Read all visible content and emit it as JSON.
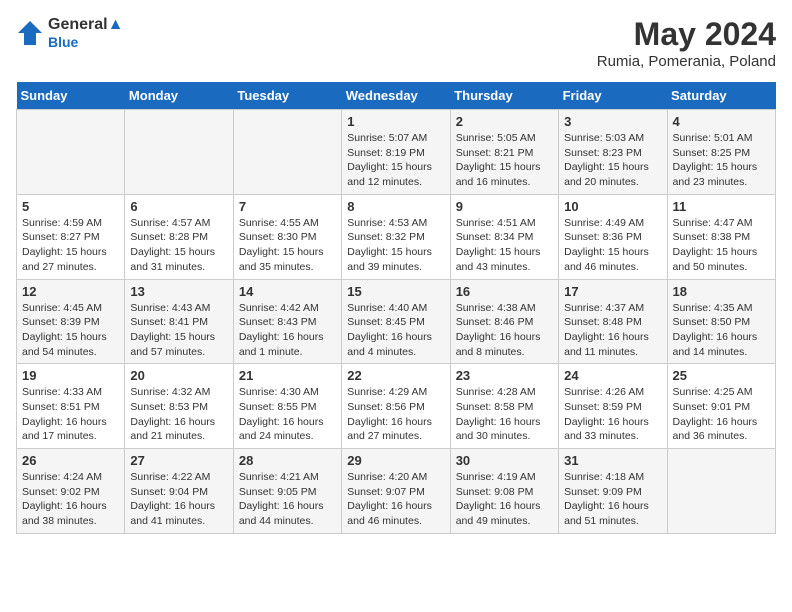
{
  "header": {
    "logo_line1": "General",
    "logo_line2": "Blue",
    "title": "May 2024",
    "subtitle": "Rumia, Pomerania, Poland"
  },
  "days_of_week": [
    "Sunday",
    "Monday",
    "Tuesday",
    "Wednesday",
    "Thursday",
    "Friday",
    "Saturday"
  ],
  "weeks": [
    [
      {
        "day": "",
        "info": ""
      },
      {
        "day": "",
        "info": ""
      },
      {
        "day": "",
        "info": ""
      },
      {
        "day": "1",
        "info": "Sunrise: 5:07 AM\nSunset: 8:19 PM\nDaylight: 15 hours\nand 12 minutes."
      },
      {
        "day": "2",
        "info": "Sunrise: 5:05 AM\nSunset: 8:21 PM\nDaylight: 15 hours\nand 16 minutes."
      },
      {
        "day": "3",
        "info": "Sunrise: 5:03 AM\nSunset: 8:23 PM\nDaylight: 15 hours\nand 20 minutes."
      },
      {
        "day": "4",
        "info": "Sunrise: 5:01 AM\nSunset: 8:25 PM\nDaylight: 15 hours\nand 23 minutes."
      }
    ],
    [
      {
        "day": "5",
        "info": "Sunrise: 4:59 AM\nSunset: 8:27 PM\nDaylight: 15 hours\nand 27 minutes."
      },
      {
        "day": "6",
        "info": "Sunrise: 4:57 AM\nSunset: 8:28 PM\nDaylight: 15 hours\nand 31 minutes."
      },
      {
        "day": "7",
        "info": "Sunrise: 4:55 AM\nSunset: 8:30 PM\nDaylight: 15 hours\nand 35 minutes."
      },
      {
        "day": "8",
        "info": "Sunrise: 4:53 AM\nSunset: 8:32 PM\nDaylight: 15 hours\nand 39 minutes."
      },
      {
        "day": "9",
        "info": "Sunrise: 4:51 AM\nSunset: 8:34 PM\nDaylight: 15 hours\nand 43 minutes."
      },
      {
        "day": "10",
        "info": "Sunrise: 4:49 AM\nSunset: 8:36 PM\nDaylight: 15 hours\nand 46 minutes."
      },
      {
        "day": "11",
        "info": "Sunrise: 4:47 AM\nSunset: 8:38 PM\nDaylight: 15 hours\nand 50 minutes."
      }
    ],
    [
      {
        "day": "12",
        "info": "Sunrise: 4:45 AM\nSunset: 8:39 PM\nDaylight: 15 hours\nand 54 minutes."
      },
      {
        "day": "13",
        "info": "Sunrise: 4:43 AM\nSunset: 8:41 PM\nDaylight: 15 hours\nand 57 minutes."
      },
      {
        "day": "14",
        "info": "Sunrise: 4:42 AM\nSunset: 8:43 PM\nDaylight: 16 hours\nand 1 minute."
      },
      {
        "day": "15",
        "info": "Sunrise: 4:40 AM\nSunset: 8:45 PM\nDaylight: 16 hours\nand 4 minutes."
      },
      {
        "day": "16",
        "info": "Sunrise: 4:38 AM\nSunset: 8:46 PM\nDaylight: 16 hours\nand 8 minutes."
      },
      {
        "day": "17",
        "info": "Sunrise: 4:37 AM\nSunset: 8:48 PM\nDaylight: 16 hours\nand 11 minutes."
      },
      {
        "day": "18",
        "info": "Sunrise: 4:35 AM\nSunset: 8:50 PM\nDaylight: 16 hours\nand 14 minutes."
      }
    ],
    [
      {
        "day": "19",
        "info": "Sunrise: 4:33 AM\nSunset: 8:51 PM\nDaylight: 16 hours\nand 17 minutes."
      },
      {
        "day": "20",
        "info": "Sunrise: 4:32 AM\nSunset: 8:53 PM\nDaylight: 16 hours\nand 21 minutes."
      },
      {
        "day": "21",
        "info": "Sunrise: 4:30 AM\nSunset: 8:55 PM\nDaylight: 16 hours\nand 24 minutes."
      },
      {
        "day": "22",
        "info": "Sunrise: 4:29 AM\nSunset: 8:56 PM\nDaylight: 16 hours\nand 27 minutes."
      },
      {
        "day": "23",
        "info": "Sunrise: 4:28 AM\nSunset: 8:58 PM\nDaylight: 16 hours\nand 30 minutes."
      },
      {
        "day": "24",
        "info": "Sunrise: 4:26 AM\nSunset: 8:59 PM\nDaylight: 16 hours\nand 33 minutes."
      },
      {
        "day": "25",
        "info": "Sunrise: 4:25 AM\nSunset: 9:01 PM\nDaylight: 16 hours\nand 36 minutes."
      }
    ],
    [
      {
        "day": "26",
        "info": "Sunrise: 4:24 AM\nSunset: 9:02 PM\nDaylight: 16 hours\nand 38 minutes."
      },
      {
        "day": "27",
        "info": "Sunrise: 4:22 AM\nSunset: 9:04 PM\nDaylight: 16 hours\nand 41 minutes."
      },
      {
        "day": "28",
        "info": "Sunrise: 4:21 AM\nSunset: 9:05 PM\nDaylight: 16 hours\nand 44 minutes."
      },
      {
        "day": "29",
        "info": "Sunrise: 4:20 AM\nSunset: 9:07 PM\nDaylight: 16 hours\nand 46 minutes."
      },
      {
        "day": "30",
        "info": "Sunrise: 4:19 AM\nSunset: 9:08 PM\nDaylight: 16 hours\nand 49 minutes."
      },
      {
        "day": "31",
        "info": "Sunrise: 4:18 AM\nSunset: 9:09 PM\nDaylight: 16 hours\nand 51 minutes."
      },
      {
        "day": "",
        "info": ""
      }
    ]
  ]
}
